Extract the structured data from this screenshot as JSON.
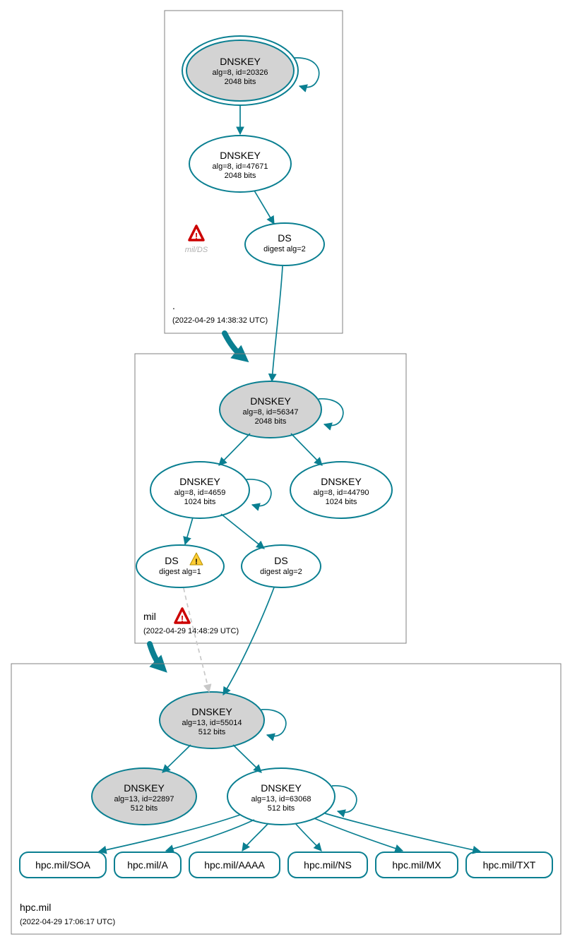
{
  "chart_data": {
    "type": "graph",
    "zones": [
      {
        "id": "root",
        "label": ".",
        "timestamp": "(2022-04-29 14:38:32 UTC)",
        "nodes": [
          {
            "id": "root-ksk",
            "title": "DNSKEY",
            "line1": "alg=8, id=20326",
            "line2": "2048 bits",
            "ksk": true,
            "double": true
          },
          {
            "id": "root-zsk",
            "title": "DNSKEY",
            "line1": "alg=8, id=47671",
            "line2": "2048 bits"
          },
          {
            "id": "root-ds",
            "title": "DS",
            "line1": "digest alg=2"
          }
        ],
        "faded": {
          "label": "mil/DS",
          "icon": "error"
        }
      },
      {
        "id": "mil",
        "label": "mil",
        "timestamp": "(2022-04-29 14:48:29 UTC)",
        "nodes": [
          {
            "id": "mil-ksk",
            "title": "DNSKEY",
            "line1": "alg=8, id=56347",
            "line2": "2048 bits",
            "ksk": true
          },
          {
            "id": "mil-zsk1",
            "title": "DNSKEY",
            "line1": "alg=8, id=4659",
            "line2": "1024 bits"
          },
          {
            "id": "mil-zsk2",
            "title": "DNSKEY",
            "line1": "alg=8, id=44790",
            "line2": "1024 bits"
          },
          {
            "id": "mil-ds1",
            "title": "DS",
            "line1": "digest alg=1",
            "warn": "warning"
          },
          {
            "id": "mil-ds2",
            "title": "DS",
            "line1": "digest alg=2"
          }
        ],
        "inline_icon": "error"
      },
      {
        "id": "hpc",
        "label": "hpc.mil",
        "timestamp": "(2022-04-29 17:06:17 UTC)",
        "nodes": [
          {
            "id": "hpc-ksk",
            "title": "DNSKEY",
            "line1": "alg=13, id=55014",
            "line2": "512 bits",
            "ksk": true
          },
          {
            "id": "hpc-zsk1",
            "title": "DNSKEY",
            "line1": "alg=13, id=22897",
            "line2": "512 bits",
            "grey": true
          },
          {
            "id": "hpc-zsk2",
            "title": "DNSKEY",
            "line1": "alg=13, id=63068",
            "line2": "512 bits"
          }
        ],
        "rrsets": [
          {
            "id": "rr-soa",
            "label": "hpc.mil/SOA"
          },
          {
            "id": "rr-a",
            "label": "hpc.mil/A"
          },
          {
            "id": "rr-aaaa",
            "label": "hpc.mil/AAAA"
          },
          {
            "id": "rr-ns",
            "label": "hpc.mil/NS"
          },
          {
            "id": "rr-mx",
            "label": "hpc.mil/MX"
          },
          {
            "id": "rr-txt",
            "label": "hpc.mil/TXT"
          }
        ]
      }
    ]
  }
}
